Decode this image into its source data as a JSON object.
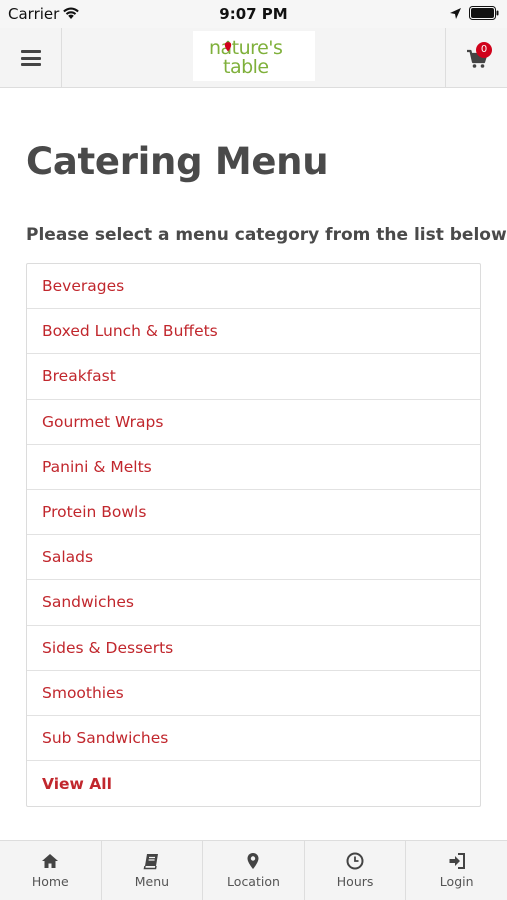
{
  "status_bar": {
    "carrier": "Carrier",
    "time": "9:07 PM"
  },
  "header": {
    "logo_line1": "nature's",
    "logo_line2": "table",
    "cart_count": "0",
    "brand_color": "#7fb03b",
    "badge_color": "#d0021b"
  },
  "main": {
    "title": "Catering Menu",
    "subtitle": "Please select a menu category from the list below",
    "categories": [
      "Beverages",
      "Boxed Lunch & Buffets",
      "Breakfast",
      "Gourmet Wraps",
      "Panini & Melts",
      "Protein Bowls",
      "Salads",
      "Sandwiches",
      "Sides & Desserts",
      "Smoothies",
      "Sub Sandwiches"
    ],
    "view_all": "View All",
    "link_color": "#c1272d"
  },
  "bottom_nav": {
    "items": [
      {
        "label": "Home",
        "icon": "home-icon"
      },
      {
        "label": "Menu",
        "icon": "book-icon"
      },
      {
        "label": "Location",
        "icon": "map-pin-icon"
      },
      {
        "label": "Hours",
        "icon": "clock-icon"
      },
      {
        "label": "Login",
        "icon": "sign-in-icon"
      }
    ]
  }
}
